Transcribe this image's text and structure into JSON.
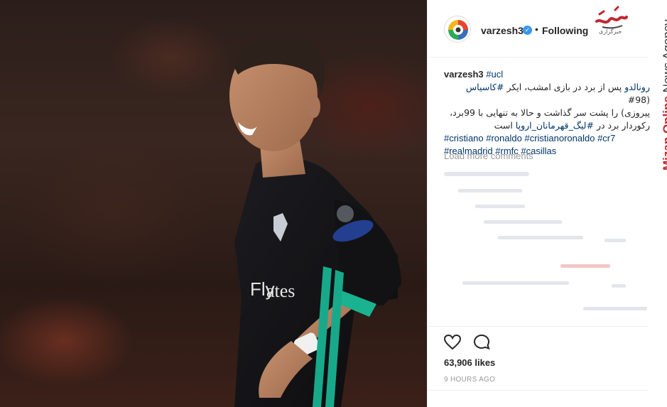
{
  "post": {
    "username": "varzesh3",
    "verified_icon": "verified-badge-icon",
    "separator": "•",
    "follow_state": "Following",
    "caption": {
      "user": "varzesh3",
      "tag_first": "#ucl",
      "persian_line1_tag": "رونالدو",
      "persian_line1_text": " پس از برد در بازی امشب، ایکر ",
      "persian_line1_tag2": "#کاسیاس",
      "persian_line1_tail": " (98#",
      "persian_line2": "پیروزی) را پشت سر گذاشت و حالا به تنهایی با 99برد،",
      "persian_line3_text": "رکوردار برد در ",
      "persian_line3_tag": "#لیگ_قهرمانان_اروپا",
      "persian_line3_tail": " است",
      "hashtags_line1": "#cristiano #ronaldo #cristianoronaldo #cr7",
      "hashtags_line2": "#realmadrid #rmfc #casillas"
    },
    "load_more": "Load more comments",
    "likes": "63,906 likes",
    "time_ago": "9 HOURS AGO",
    "icons": {
      "like": "heart-icon",
      "comment": "comment-bubble-icon"
    }
  },
  "watermark": {
    "brand": "Mizan Online",
    "rest": " News Agency",
    "logo_caption": "خبرگزاری"
  },
  "colors": {
    "hashtag": "#003569",
    "verified": "#3897f0",
    "watermark_red": "#c1272d",
    "muted": "#999999"
  }
}
